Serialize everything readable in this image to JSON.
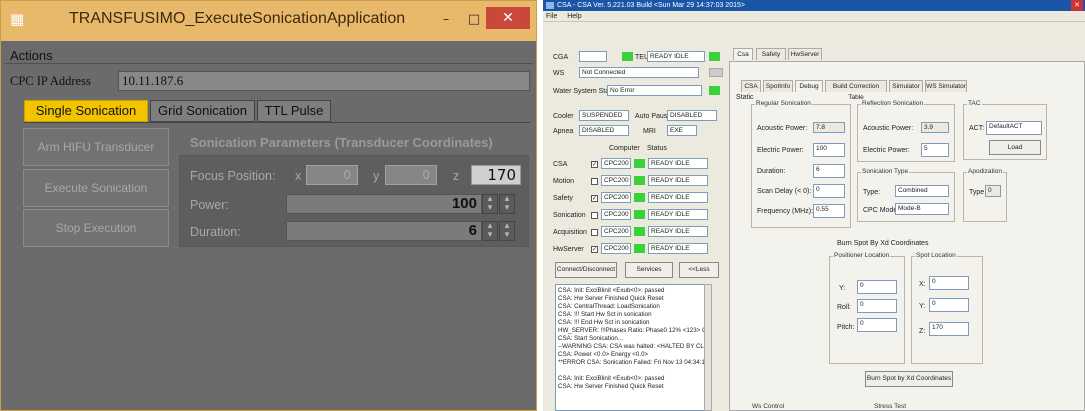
{
  "left": {
    "title": "TRANSFUSIMO_ExecuteSonicationApplication",
    "window_buttons": {
      "minimize": "–",
      "maximize": "□",
      "close": "✕"
    },
    "actions_label": "Actions",
    "cpc_label": "CPC IP Address",
    "cpc_value": "10.11.187.6",
    "tabs": [
      "Single Sonication",
      "Grid Sonication",
      "TTL Pulse"
    ],
    "buttons": {
      "arm": "Arm HIFU Transducer",
      "execute": "Execute Sonication",
      "stop": "Stop Execution"
    },
    "params_header": "Sonication Parameters (Transducer Coordinates)",
    "focus_label": "Focus Position:",
    "x_label": "x",
    "x_value": "0",
    "y_label": "y",
    "y_value": "0",
    "z_label": "z",
    "z_value": "170",
    "power_label": "Power:",
    "power_value": "100",
    "duration_label": "Duration:",
    "duration_value": "6"
  },
  "right": {
    "title": "CSA - CSA Ver. 5.221.03 Build <Sun Mar 29 14:37:03 2015>",
    "menu": [
      "File",
      "Help"
    ],
    "cga_label": "CGA",
    "teu_label": "TEU",
    "teu_status": "READY IDLE",
    "ws_label": "WS",
    "ws_value": "Not Connected",
    "water_label": "Water System Status:",
    "water_value": "No Error",
    "cooler_label": "Cooler",
    "cooler_value": "SUSPENDED",
    "autopause_label": "Auto Pause",
    "autopause_value": "DISABLED",
    "apnea_label": "Apnea",
    "apnea_value": "DISABLED",
    "mri_label": "MRI",
    "mri_value": "EXE",
    "computer_hdr": "Computer",
    "status_hdr": "Status",
    "modules": [
      {
        "name": "CSA",
        "checked": true,
        "computer": "CPC200",
        "status": "READY IDLE"
      },
      {
        "name": "Motion",
        "checked": false,
        "computer": "CPC200",
        "status": "READY IDLE"
      },
      {
        "name": "Safety",
        "checked": true,
        "computer": "CPC200",
        "status": "READY IDLE"
      },
      {
        "name": "Sonication",
        "checked": false,
        "computer": "CPC200",
        "status": "READY IDLE"
      },
      {
        "name": "Acquisition",
        "checked": false,
        "computer": "CPC200",
        "status": "READY IDLE"
      },
      {
        "name": "HwServer",
        "checked": true,
        "computer": "CPC200",
        "status": "READY IDLE"
      }
    ],
    "btn_connect": "Connect/Disconnect",
    "btn_services": "Services",
    "btn_less": "<<Less",
    "log": [
      "CSA: Init: ExciBlinit <Exub<0>: passed",
      "CSA: Hw Server Finished Quick Reset",
      "CSA: CentralThread: LoadSonication",
      "CSA: !!! Start Hw Sct in sonication",
      "CSA: !!! End Hw Sct in sonication",
      "HW_SERVER: !!!Phases Ratio: Phase0 12% <123> ClPhe",
      "CSA: Start Sonication...",
      "--WARNING CSA: CSA was halted: <HALTED BY CLIENT>",
      "CSA:     Power <0.0>     Energy <0.0>",
      "**ERROR CSA: Sonication Failed: Fri Nov 13 04:34:13:20",
      "",
      "CSA: Init: ExciBlinit <Exub<0>: passed",
      "CSA: Hw Server Finished Quick Reset"
    ],
    "top_tabs": [
      "Csa",
      "Safety",
      "HwServer"
    ],
    "sub_tabs": [
      "CSA",
      "SpotInfo",
      "Debug",
      "Build Correction Table",
      "Simulator",
      "WS Simulator"
    ],
    "static_label": "Static",
    "regular_label": "Regular Sonication",
    "acoustic_label": "Acoustic Power:",
    "acoustic_value": "7.8",
    "electric_label": "Electric Power:",
    "electric_value": "100",
    "duration_label": "Duration:",
    "duration_value": "6",
    "scandelay_label": "Scan Delay (< 0):",
    "scandelay_value": "0",
    "freq_label": "Frequency (MHz):",
    "freq_value": "0.55",
    "reflection_label": "Reflection Sonication",
    "r_acoustic_label": "Acoustic Power:",
    "r_acoustic_value": "3.9",
    "r_electric_label": "Electric Power:",
    "r_electric_value": "5",
    "tac_label": "TAC",
    "act_label": "ACT:",
    "act_value": "DefaultACT",
    "load_label": "Load",
    "sontype_label": "Sonication Type",
    "type_label": "Type:",
    "type_value": "Combined",
    "cpcmode_label": "CPC Mode:",
    "cpcmode_value": "Mode-B",
    "apod_label": "Apodization",
    "apod_type_label": "Type",
    "apod_type_value": "0",
    "burn_label": "Burn Spot By Xd Coordinates",
    "pos_label": "Positioner Location",
    "y_label": "Y:",
    "y_value": "0",
    "roll_label": "Roll:",
    "roll_value": "0",
    "pitch_label": "Pitch:",
    "pitch_value": "0",
    "spot_label": "Spot Location",
    "sx_label": "X:",
    "sx_value": "0",
    "sy_label": "Y:",
    "sy_value": "0",
    "sz_label": "Z:",
    "sz_value": "170",
    "burn_btn": "Burn Spot by Xd Coordinates",
    "wscontrol_label": "Ws Control",
    "stresstest_label": "Stress Test"
  }
}
